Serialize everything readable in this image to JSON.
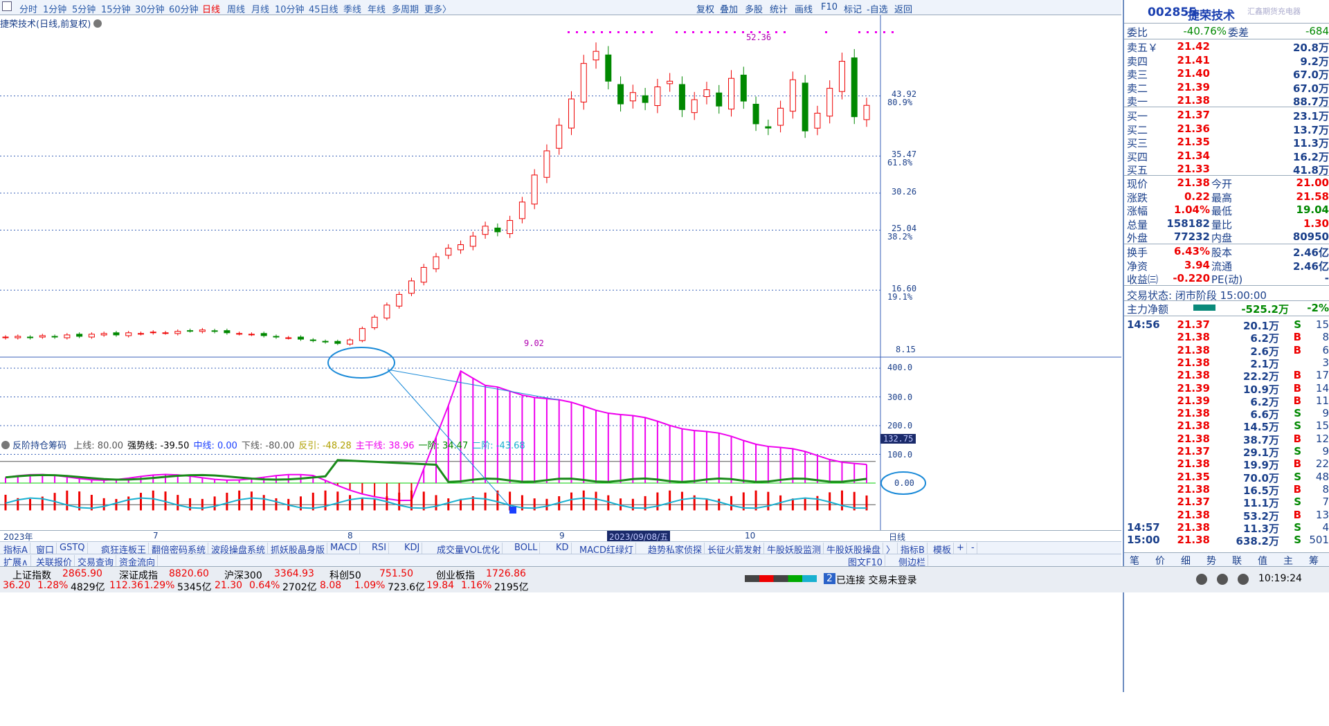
{
  "toolbar": {
    "items": [
      "分时",
      "1分钟",
      "5分钟",
      "15分钟",
      "30分钟",
      "60分钟",
      "日线",
      "周线",
      "月线",
      "10分钟",
      "45日线",
      "季线",
      "年线",
      "多周期",
      "更多〉"
    ],
    "active": "日线",
    "right": [
      "复权",
      "叠加",
      "多股",
      "统计",
      "画线",
      "F10",
      "标记",
      "-自选",
      "返回"
    ]
  },
  "chart": {
    "title": "捷荣技术(日线,前复权)",
    "price_labels": [
      "43.92",
      "35.47",
      "30.26",
      "25.04",
      "16.60",
      "8.15"
    ],
    "pct_labels": [
      "80.9%",
      "61.8%",
      "38.2%",
      "19.1%"
    ],
    "high_label": "52.36",
    "low_label": "9.02",
    "ind_axis": [
      "400.0",
      "300.0",
      "200.0",
      "100.0",
      "0.00"
    ],
    "ind_current": "132.75"
  },
  "chart_data": {
    "type": "candlestick",
    "title": "捷荣技术(日线,前复权)",
    "ylim": [
      8.15,
      52.36
    ],
    "high": 52.36,
    "low": 9.02,
    "closes": [
      10.0,
      10.1,
      9.9,
      10.2,
      10.0,
      10.3,
      10.1,
      10.4,
      10.5,
      10.3,
      10.6,
      10.5,
      10.7,
      10.6,
      10.8,
      10.9,
      11.0,
      10.8,
      10.6,
      10.5,
      10.4,
      10.2,
      10.0,
      9.9,
      9.7,
      9.5,
      9.3,
      9.1,
      9.6,
      11.2,
      12.8,
      14.5,
      16.0,
      17.9,
      19.8,
      21.3,
      22.5,
      23.0,
      24.2,
      25.6,
      24.8,
      26.4,
      29.0,
      32.8,
      36.2,
      39.8,
      43.5,
      48.5,
      50.2,
      46.0,
      42.8,
      44.4,
      43.0,
      45.2,
      46.0,
      42.0,
      43.4,
      44.8,
      42.5,
      46.4,
      43.2,
      40.0,
      39.4,
      42.2,
      46.2,
      39.0,
      41.5,
      45.0,
      48.8,
      41.0,
      42.6
    ],
    "indicator": {
      "name": "反阶持仓筹码",
      "series": [
        {
          "name": "上线",
          "value": 80.0
        },
        {
          "name": "强势线",
          "value": -39.5
        },
        {
          "name": "中线",
          "value": 0.0
        },
        {
          "name": "下线",
          "value": -80.0
        },
        {
          "name": "反引",
          "value": -48.28
        },
        {
          "name": "主干线",
          "value": 38.96
        },
        {
          "name": "一阶",
          "value": 34.47
        },
        {
          "name": "二阶",
          "value": -43.68
        }
      ]
    }
  },
  "indicator_bar": {
    "name": "反阶持仓筹码",
    "items": [
      {
        "label": "上线: 80.00",
        "color": "#555"
      },
      {
        "label": "强势线: -39.50",
        "color": "#000"
      },
      {
        "label": "中线: 0.00",
        "color": "#1a3fff"
      },
      {
        "label": "下线: -80.00",
        "color": "#555"
      },
      {
        "label": "反引: -48.28",
        "color": "#b0a000"
      },
      {
        "label": "主干线: 38.96",
        "color": "#e0e"
      },
      {
        "label": "一阶: 34.47",
        "color": "#080"
      },
      {
        "label": "二阶: -43.68",
        "color": "#18b0d0"
      }
    ]
  },
  "xaxis": {
    "labels": [
      "2023年",
      "7",
      "8",
      "9",
      "10"
    ],
    "date": "2023/09/08/五",
    "right": "日线"
  },
  "tabs1": [
    "指标A",
    "窗口",
    "GSTQ",
    "疯狂连板王",
    "翻倍密码系统",
    "波段操盘系统",
    "抓妖股晶身版",
    "MACD",
    "RSI",
    "KDJ",
    "成交量VOL优化",
    "BOLL",
    "KD",
    "MACD红绿灯",
    "趋势私家侦探",
    "长征火箭发射",
    "牛股妖股监测",
    "牛股妖股操盘",
    "〉",
    "指标B",
    "模板",
    "+",
    "-"
  ],
  "tabs2": [
    "扩展∧",
    "关联报价",
    "交易查询",
    "资金流向"
  ],
  "tabs2_right": [
    "图文F10",
    "侧边栏"
  ],
  "quote": {
    "code": "002855",
    "name": "捷荣技术",
    "ad": "汇鑫期货充电器",
    "wb_label": "委比",
    "wb": "-40.76%",
    "wc_label": "委差",
    "wc": "-684",
    "sell": [
      {
        "l": "卖五￥",
        "p": "21.42",
        "v": "20.8万"
      },
      {
        "l": "卖四",
        "p": "21.41",
        "v": "9.2万"
      },
      {
        "l": "卖三",
        "p": "21.40",
        "v": "67.0万"
      },
      {
        "l": "卖二",
        "p": "21.39",
        "v": "67.0万"
      },
      {
        "l": "卖一",
        "p": "21.38",
        "v": "88.7万"
      }
    ],
    "buy": [
      {
        "l": "买一",
        "p": "21.37",
        "v": "23.1万"
      },
      {
        "l": "买二",
        "p": "21.36",
        "v": "13.7万"
      },
      {
        "l": "买三",
        "p": "21.35",
        "v": "11.3万"
      },
      {
        "l": "买四",
        "p": "21.34",
        "v": "16.2万"
      },
      {
        "l": "买五",
        "p": "21.33",
        "v": "41.8万"
      }
    ],
    "stats": [
      {
        "a": "现价",
        "b": "21.38",
        "c": "今开",
        "d": "21.00"
      },
      {
        "a": "涨跌",
        "b": "0.22",
        "c": "最高",
        "d": "21.58"
      },
      {
        "a": "涨幅",
        "b": "1.04%",
        "c": "最低",
        "d": "19.04"
      },
      {
        "a": "总量",
        "b": "158182",
        "c": "量比",
        "d": "1.30"
      },
      {
        "a": "外盘",
        "b": "77232",
        "c": "内盘",
        "d": "80950"
      }
    ],
    "stats2": [
      {
        "a": "换手",
        "b": "6.43%",
        "c": "股本",
        "d": "2.46亿"
      },
      {
        "a": "净资",
        "b": "3.94",
        "c": "流通",
        "d": "2.46亿"
      },
      {
        "a": "收益㈢",
        "b": "-0.220",
        "c": "PE(动)",
        "d": "-"
      }
    ],
    "status": "交易状态: 闭市阶段 15:00:00",
    "flow_label": "主力净额",
    "flow_val": "-525.2万",
    "flow_pct": "-2%",
    "ticks": [
      {
        "t": "14:56",
        "p": "21.37",
        "v": "20.1万",
        "s": "S",
        "n": "15"
      },
      {
        "t": "",
        "p": "21.38",
        "v": "6.2万",
        "s": "B",
        "n": "8"
      },
      {
        "t": "",
        "p": "21.38",
        "v": "2.6万",
        "s": "B",
        "n": "6"
      },
      {
        "t": "",
        "p": "21.38",
        "v": "2.1万",
        "s": "",
        "n": "3"
      },
      {
        "t": "",
        "p": "21.38",
        "v": "22.2万",
        "s": "B",
        "n": "17"
      },
      {
        "t": "",
        "p": "21.39",
        "v": "10.9万",
        "s": "B",
        "n": "14"
      },
      {
        "t": "",
        "p": "21.39",
        "v": "6.2万",
        "s": "B",
        "n": "11"
      },
      {
        "t": "",
        "p": "21.38",
        "v": "6.6万",
        "s": "S",
        "n": "9"
      },
      {
        "t": "",
        "p": "21.38",
        "v": "14.5万",
        "s": "S",
        "n": "15"
      },
      {
        "t": "",
        "p": "21.38",
        "v": "38.7万",
        "s": "B",
        "n": "12"
      },
      {
        "t": "",
        "p": "21.37",
        "v": "29.1万",
        "s": "S",
        "n": "9"
      },
      {
        "t": "",
        "p": "21.38",
        "v": "19.9万",
        "s": "B",
        "n": "22"
      },
      {
        "t": "",
        "p": "21.35",
        "v": "70.0万",
        "s": "S",
        "n": "48"
      },
      {
        "t": "",
        "p": "21.38",
        "v": "16.5万",
        "s": "B",
        "n": "8"
      },
      {
        "t": "",
        "p": "21.37",
        "v": "11.1万",
        "s": "S",
        "n": "7"
      },
      {
        "t": "",
        "p": "21.38",
        "v": "53.2万",
        "s": "B",
        "n": "13"
      },
      {
        "t": "14:57",
        "p": "21.38",
        "v": "11.3万",
        "s": "S",
        "n": "4"
      },
      {
        "t": "15:00",
        "p": "21.38",
        "v": "638.2万",
        "s": "S",
        "n": "501"
      }
    ],
    "btabs": [
      "笔",
      "价",
      "细",
      "势",
      "联",
      "值",
      "主",
      "筹"
    ]
  },
  "bottom": {
    "indices": [
      {
        "name": "上证指数",
        "val": "2865.90",
        "chg": "36.20",
        "pct": "1.28%",
        "amt": "4829亿"
      },
      {
        "name": "深证成指",
        "val": "8820.60",
        "chg": "112.36",
        "pct": "1.29%",
        "amt": "5345亿"
      },
      {
        "name": "沪深300",
        "val": "3364.93",
        "chg": "21.30",
        "pct": "0.64%",
        "amt": "2702亿"
      },
      {
        "name": "科创50",
        "val": "751.50",
        "chg": "8.08",
        "pct": "1.09%",
        "amt": "723.6亿"
      },
      {
        "name": "创业板指",
        "val": "1726.86",
        "chg": "19.84",
        "pct": "1.16%",
        "amt": "2195亿"
      }
    ],
    "conn_num": "2",
    "conn": "已连接 交易未登录",
    "time": "10:19:24"
  }
}
